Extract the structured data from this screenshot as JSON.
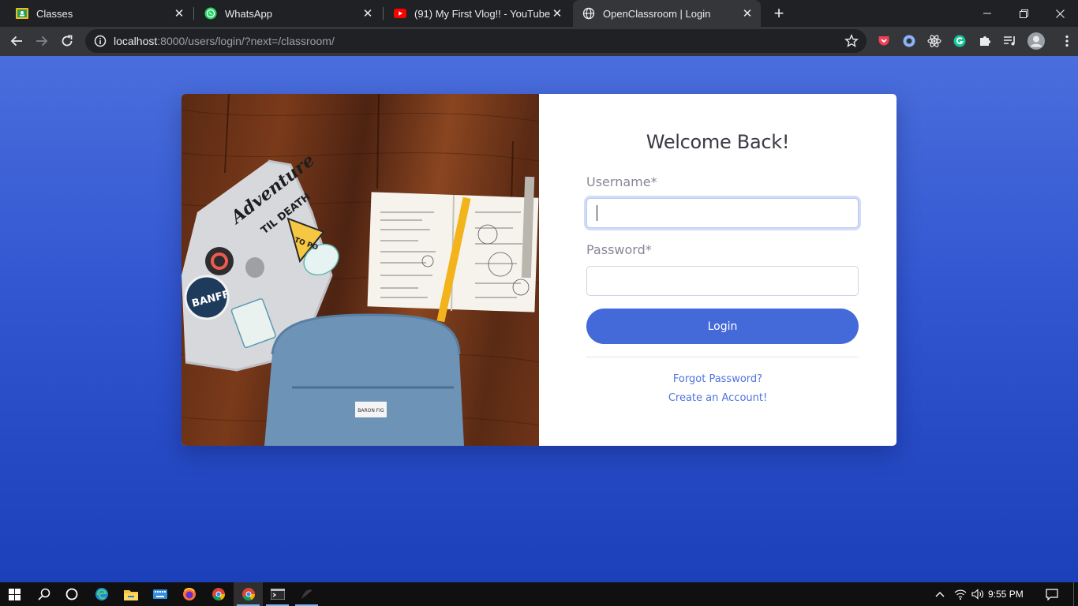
{
  "browser": {
    "tabs": [
      {
        "title": "Classes",
        "favicon": "google-classroom-icon"
      },
      {
        "title": "WhatsApp",
        "favicon": "whatsapp-icon"
      },
      {
        "title": "(91) My First Vlog!! - YouTube",
        "favicon": "youtube-icon"
      },
      {
        "title": "OpenClassroom | Login",
        "favicon": "globe-icon",
        "active": true
      }
    ],
    "url_host": "localhost",
    "url_rest": ":8000/users/login/?next=/classroom/"
  },
  "login": {
    "heading": "Welcome Back!",
    "username_label": "Username*",
    "username_value": "",
    "password_label": "Password*",
    "password_value": "",
    "login_button": "Login",
    "forgot_link": "Forgot Password?",
    "create_link": "Create an Account!"
  },
  "photo": {
    "sticker_adventure": "Adventure",
    "sticker_til_death": "TIL DEATH",
    "sticker_banff": "BANFF",
    "sticker_topo": "TO PO",
    "bag_label": "BARON FIG"
  },
  "taskbar": {
    "time": "9:55 PM"
  },
  "colors": {
    "accent": "#4469d8",
    "page_bg_top": "#4a6edc",
    "page_bg_bottom": "#1c3fba",
    "link": "#4e73df"
  }
}
